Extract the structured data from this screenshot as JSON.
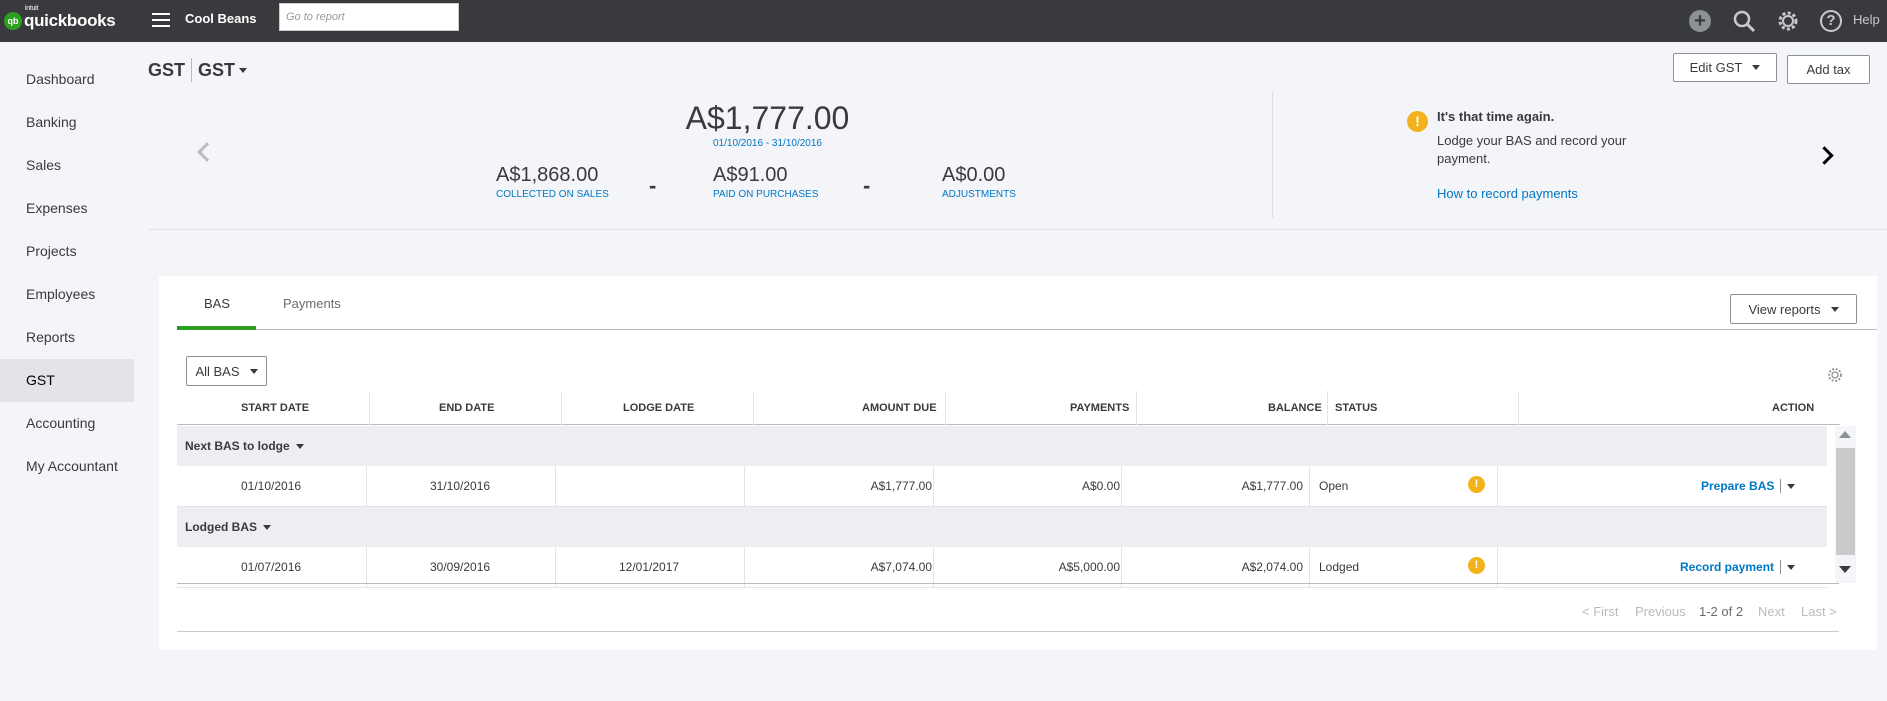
{
  "topbar": {
    "logo_small": "intuit",
    "logo_text": "quickbooks",
    "logo_mark": "qb",
    "company": "Cool Beans",
    "search_placeholder": "Go to report",
    "help_label": "Help",
    "icons": [
      "plus-icon",
      "search-icon",
      "gear-icon",
      "help-icon"
    ]
  },
  "sidebar": {
    "items": [
      {
        "label": "Dashboard"
      },
      {
        "label": "Banking"
      },
      {
        "label": "Sales"
      },
      {
        "label": "Expenses"
      },
      {
        "label": "Projects"
      },
      {
        "label": "Employees"
      },
      {
        "label": "Reports"
      },
      {
        "label": "GST",
        "active": true
      },
      {
        "label": "Accounting"
      },
      {
        "label": "My Accountant"
      }
    ]
  },
  "header": {
    "title": "GST",
    "selector": "GST",
    "edit_button": "Edit GST",
    "add_tax_button": "Add tax"
  },
  "summary": {
    "total": "A$1,777.00",
    "period": "01/10/2016 - 31/10/2016",
    "collected": {
      "value": "A$1,868.00",
      "label": "COLLECTED ON SALES"
    },
    "paid": {
      "value": "A$91.00",
      "label": "PAID ON PURCHASES"
    },
    "adjustments": {
      "value": "A$0.00",
      "label": "ADJUSTMENTS"
    },
    "operator": "-"
  },
  "reminder": {
    "title": "It's that time again.",
    "body": "Lodge your BAS and record your payment.",
    "link": "How to record payments",
    "icon_glyph": "!"
  },
  "tabs": {
    "bas": "BAS",
    "payments": "Payments",
    "view_reports": "View reports"
  },
  "filter": {
    "selected": "All BAS"
  },
  "table": {
    "headers": {
      "start_date": "START DATE",
      "end_date": "END DATE",
      "lodge_date": "LODGE DATE",
      "amount_due": "AMOUNT DUE",
      "payments": "PAYMENTS",
      "balance": "BALANCE",
      "status": "STATUS",
      "action": "ACTION"
    },
    "groups": [
      {
        "label": "Next BAS to lodge",
        "row": {
          "start_date": "01/10/2016",
          "end_date": "31/10/2016",
          "lodge_date": "",
          "amount_due": "A$1,777.00",
          "payments": "A$0.00",
          "balance": "A$1,777.00",
          "status": "Open",
          "action": "Prepare BAS"
        }
      },
      {
        "label": "Lodged BAS",
        "row": {
          "start_date": "01/07/2016",
          "end_date": "30/09/2016",
          "lodge_date": "12/01/2017",
          "amount_due": "A$7,074.00",
          "payments": "A$5,000.00",
          "balance": "A$2,074.00",
          "status": "Lodged",
          "action": "Record payment"
        }
      }
    ]
  },
  "pagination": {
    "first": "< First",
    "previous": "Previous",
    "range": "1-2 of 2",
    "next": "Next",
    "last": "Last >"
  },
  "colors": {
    "topbar": "#393a3d",
    "accent_green": "#2ca01c",
    "link_blue": "#0077c5",
    "warning": "#f2b21c"
  }
}
